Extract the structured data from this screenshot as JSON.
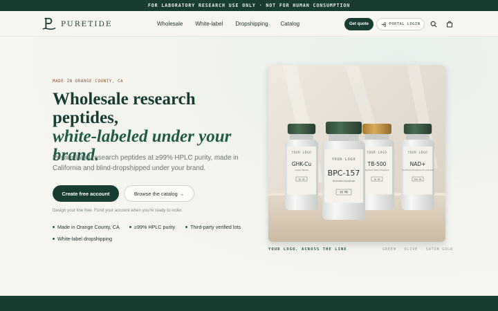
{
  "announcement": "FOR LABORATORY RESEARCH USE ONLY · NOT FOR HUMAN CONSUMPTION",
  "brand": {
    "name": "PURETIDE",
    "mark": "P"
  },
  "nav": {
    "links": [
      "Wholesale",
      "White-label",
      "Dropshipping",
      "Catalog"
    ],
    "quote_label": "Get quote",
    "portal_label": "PORTAL LOGIN",
    "icons": [
      "search-icon",
      "bag-icon"
    ]
  },
  "hero": {
    "eyebrow": "MADE IN ORANGE COUNTY, CA",
    "title_line1": "Wholesale research peptides,",
    "title_line2": "white-labeled under your brand.",
    "lead": "Private-label research peptides at ≥99% HPLC purity, made in California and blind-dropshipped under your brand.",
    "primary_cta": "Create free account",
    "secondary_cta": "Browse the catalog →",
    "note": "Design your line free. Fund your account when you're ready to order.",
    "features": [
      "Made in Orange County, CA",
      "≥99% HPLC purity",
      "Third-party verified lots",
      "White-label dropshipping"
    ]
  },
  "showcase": {
    "caption_left": "YOUR LOGO, ACROSS THE LINE",
    "caption_right": "GREEN · OLIVE · SATIN GOLD",
    "vials": [
      {
        "logo": "YOUR LOGO",
        "name": "GHK-Cu",
        "sub": "Copper Peptide",
        "dose": "50 MG",
        "cap": "green"
      },
      {
        "logo": "YOUR LOGO",
        "name": "BPC-157",
        "sub": "Pentadecapeptide",
        "dose": "10 MG",
        "cap": "green"
      },
      {
        "logo": "YOUR LOGO",
        "name": "TB-500",
        "sub": "Thymosin Beta-4 Fragment",
        "dose": "10 MG",
        "cap": "gold"
      },
      {
        "logo": "YOUR LOGO",
        "name": "NAD+",
        "sub": "Nicotinamide Adenine Dinucleotide",
        "dose": "500 MG",
        "cap": "green"
      }
    ]
  },
  "colors": {
    "primary": "#173d31",
    "accent": "#1e5a44",
    "eyebrow": "#8a4f2c",
    "gold": "#c99a45",
    "background": "#f6f5f0"
  }
}
